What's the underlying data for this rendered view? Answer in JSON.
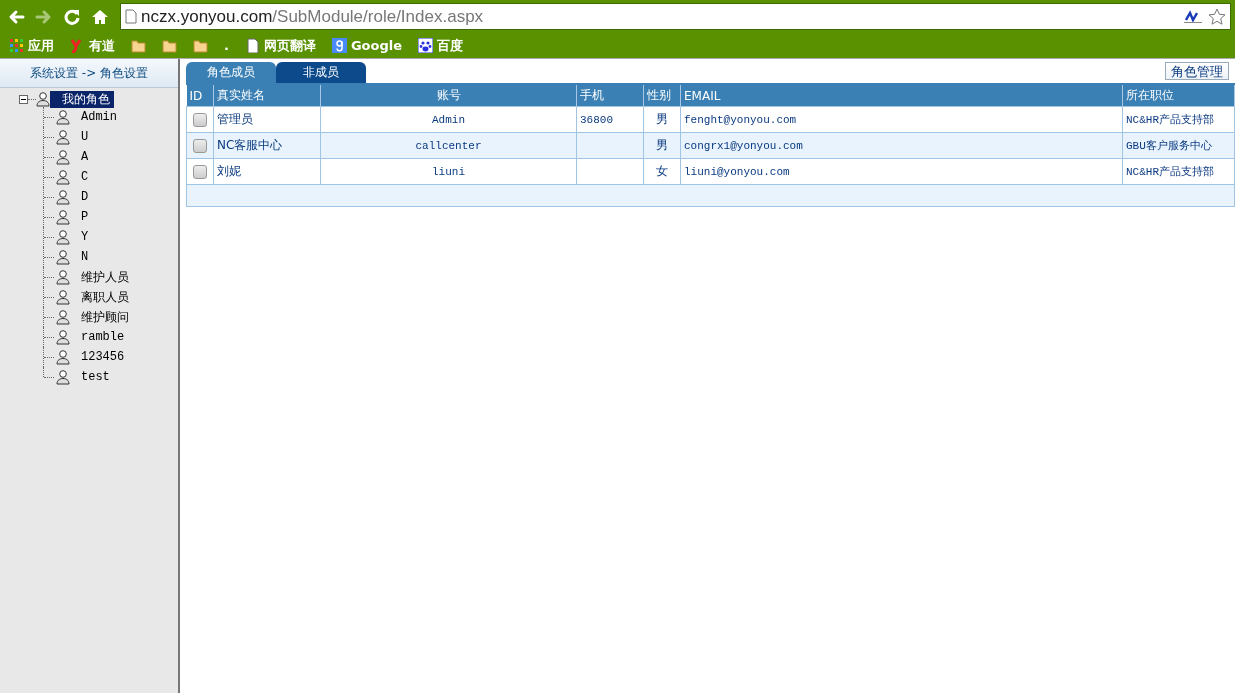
{
  "browser": {
    "nav": [
      {
        "kind": "back",
        "disabled": false
      },
      {
        "kind": "forward",
        "disabled": true
      },
      {
        "kind": "reload",
        "disabled": false
      },
      {
        "kind": "home",
        "disabled": false
      }
    ],
    "address": {
      "host": "nczx.yonyou.com",
      "path": "/SubModule/role/Index.aspx"
    },
    "bookmarks": [
      {
        "kind": "apps",
        "label": "应用"
      },
      {
        "kind": "youdao",
        "label": "有道"
      },
      {
        "kind": "folder"
      },
      {
        "kind": "folder"
      },
      {
        "kind": "folder"
      },
      {
        "kind": "text",
        "label": "."
      },
      {
        "kind": "page",
        "label": "网页翻译"
      },
      {
        "kind": "google",
        "label": "Google"
      },
      {
        "kind": "baidu",
        "label": "百度"
      }
    ]
  },
  "breadcrumb": "系统设置 -> 角色设置",
  "tree": {
    "root": {
      "label": "我的角色",
      "selected": true,
      "expanded": true,
      "children": [
        {
          "label": "Admin",
          "selected": false
        },
        {
          "label": "U",
          "selected": false
        },
        {
          "label": "A",
          "selected": false
        },
        {
          "label": "C",
          "selected": false
        },
        {
          "label": "D",
          "selected": false
        },
        {
          "label": "P",
          "selected": false
        },
        {
          "label": "Y",
          "selected": false
        },
        {
          "label": "N",
          "selected": false
        },
        {
          "label": "维护人员",
          "selected": false
        },
        {
          "label": "离职人员",
          "selected": false
        },
        {
          "label": "维护顾问",
          "selected": false
        },
        {
          "label": "ramble",
          "selected": false
        },
        {
          "label": "123456",
          "selected": false
        },
        {
          "label": "test",
          "selected": false
        }
      ]
    }
  },
  "tabs": [
    {
      "label": "角色成员",
      "selected": true
    },
    {
      "label": "非成员",
      "selected": false
    }
  ],
  "manage_button": "角色管理",
  "table": {
    "columns": [
      "ID",
      "真实姓名",
      "账号",
      "手机",
      "性别",
      "EMAIL",
      "所在职位"
    ],
    "rows": [
      {
        "checked": false,
        "name": "管理员",
        "account": "Admin",
        "phone": "36800",
        "gender": "男",
        "email": "fenght@yonyou.com",
        "position": "NC&HR产品支持部"
      },
      {
        "checked": false,
        "name": "NC客服中心",
        "account": "callcenter",
        "gender": "男",
        "email": "congrx1@yonyou.com",
        "position": "GBU客户服务中心"
      },
      {
        "checked": false,
        "name": "刘妮",
        "account": "liuni",
        "gender": "女",
        "email": "liuni@yonyou.com",
        "position": "NC&HR产品支持部"
      }
    ]
  }
}
